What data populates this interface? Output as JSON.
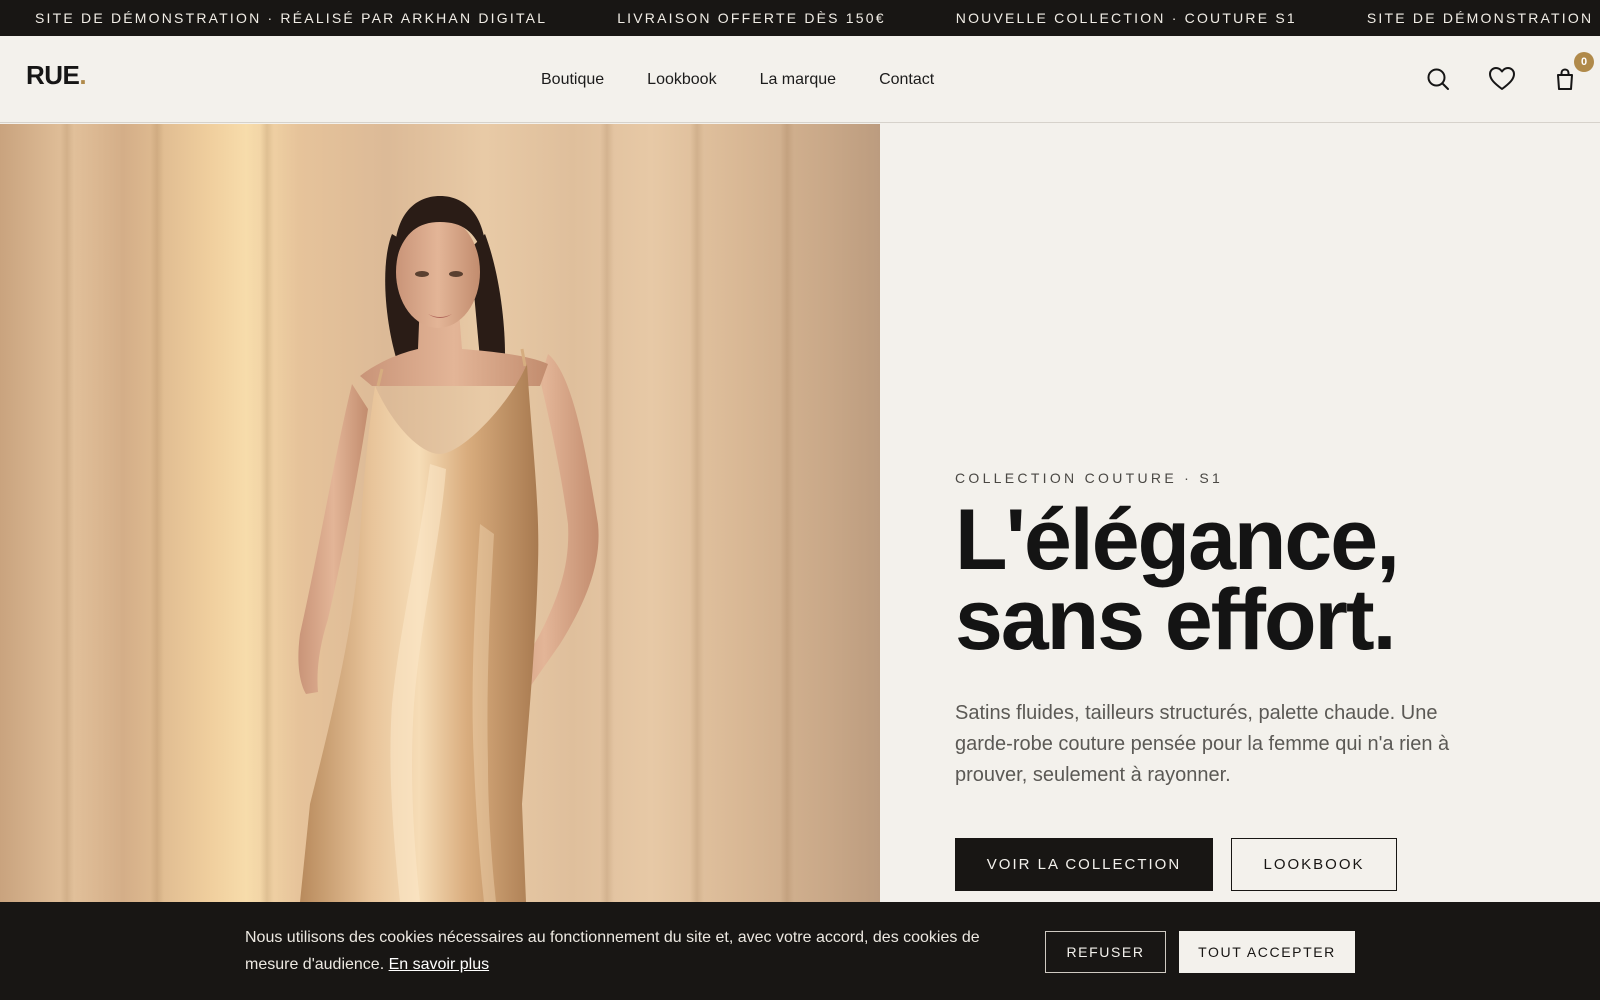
{
  "announcement": {
    "items": [
      "SITE DE DÉMONSTRATION · RÉALISÉ PAR ARKHAN DIGITAL",
      "LIVRAISON OFFERTE DÈS 150€",
      "NOUVELLE COLLECTION · COUTURE S1",
      "SITE DE DÉMONSTRATION · RÉALISÉ PAR ARKHAN DIGITAL"
    ]
  },
  "header": {
    "logo_text": "RUE",
    "logo_dot": ".",
    "nav": [
      "Boutique",
      "Lookbook",
      "La marque",
      "Contact"
    ],
    "icons": [
      "search-icon",
      "heart-icon",
      "shopping-bag-icon"
    ],
    "cart_count": "0"
  },
  "hero": {
    "eyebrow": "COLLECTION COUTURE · S1",
    "headline_line1": "L'élégance,",
    "headline_line2": "sans effort.",
    "lead": "Satins fluides, tailleurs structurés, palette chaude. Une garde-robe couture pensée pour la femme qui n'a rien à prouver, seulement à rayonner.",
    "cta_primary": "VOIR LA COLLECTION",
    "cta_secondary": "LOOKBOOK"
  },
  "cookie_banner": {
    "text": "Nous utilisons des cookies nécessaires au fonctionnement du site et, avec votre accord, des cookies de mesure d'audience.",
    "link": "En savoir plus",
    "refuse": "REFUSER",
    "accept": "TOUT ACCEPTER"
  },
  "colors": {
    "background": "#f3f1ec",
    "dark": "#181614",
    "accent": "#b08a4a"
  }
}
